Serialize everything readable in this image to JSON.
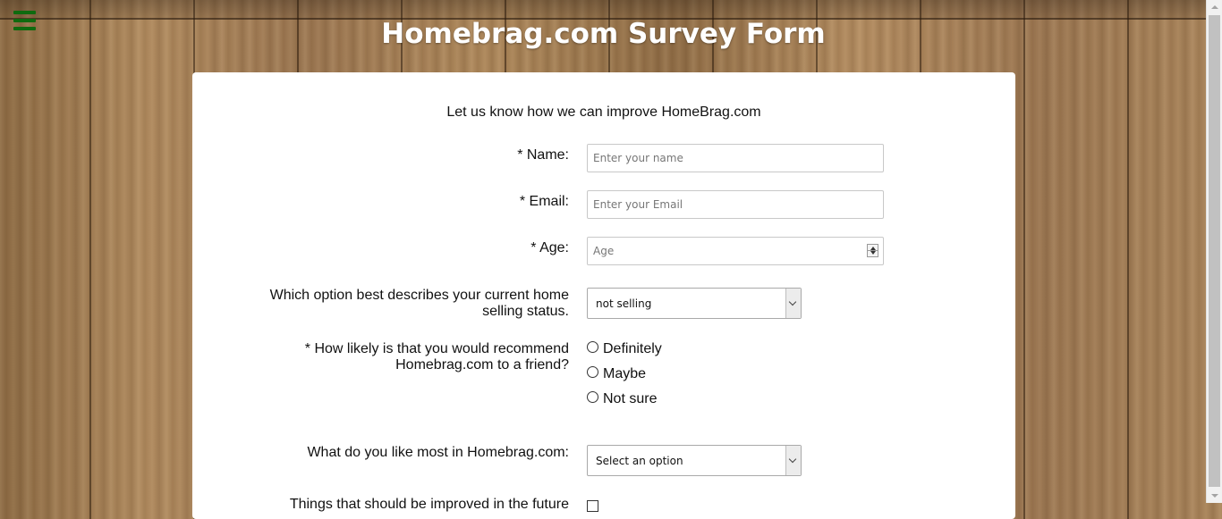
{
  "header": {
    "title": "Homebrag.com Survey Form",
    "menu_icon": "hamburger-menu-icon",
    "menu_color": "#0f6b0f"
  },
  "form": {
    "intro": "Let us know how we can improve HomeBrag.com",
    "name": {
      "label": "* Name:",
      "placeholder": "Enter your name",
      "value": ""
    },
    "email": {
      "label": "* Email:",
      "placeholder": "Enter your Email",
      "value": ""
    },
    "age": {
      "label": "* Age:",
      "placeholder": "Age",
      "value": ""
    },
    "selling_status": {
      "label_line1": "Which option best describes your current home",
      "label_line2": "selling status.",
      "selected": "not selling"
    },
    "recommend": {
      "label_line1": "* How likely is that you would recommend",
      "label_line2": "Homebrag.com to a friend?",
      "options": [
        "Definitely",
        "Maybe",
        "Not sure"
      ]
    },
    "like_most": {
      "label": "What do you like most in Homebrag.com:",
      "selected": "Select an option"
    },
    "improve": {
      "label": "Things that should be improved in the future"
    }
  },
  "colors": {
    "card_background": "#ffffff",
    "title_color": "#ffffff"
  }
}
